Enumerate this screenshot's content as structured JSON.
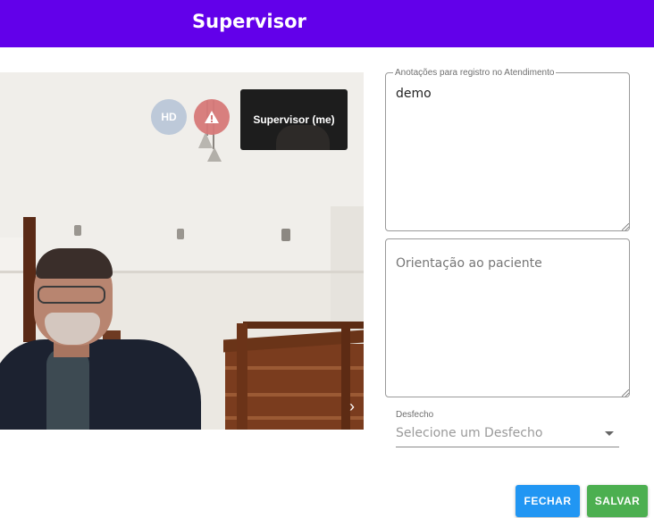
{
  "header": {
    "title": "Supervisor"
  },
  "video": {
    "quality_badge": "HD",
    "warning_icon": "warning-triangle-icon",
    "self_view_label": "Supervisor (me)",
    "next_icon": "chevron-right-icon"
  },
  "form": {
    "notes": {
      "label": "Anotações para registro no Atendimento",
      "value": "demo"
    },
    "orientation": {
      "placeholder": "Orientação ao paciente"
    },
    "outcome": {
      "label": "Desfecho",
      "placeholder": "Selecione um Desfecho"
    }
  },
  "actions": {
    "close_label": "FECHAR",
    "save_label": "SALVAR"
  },
  "colors": {
    "header": "#6200ea",
    "close_button": "#2196f3",
    "save_button": "#4caf50"
  }
}
